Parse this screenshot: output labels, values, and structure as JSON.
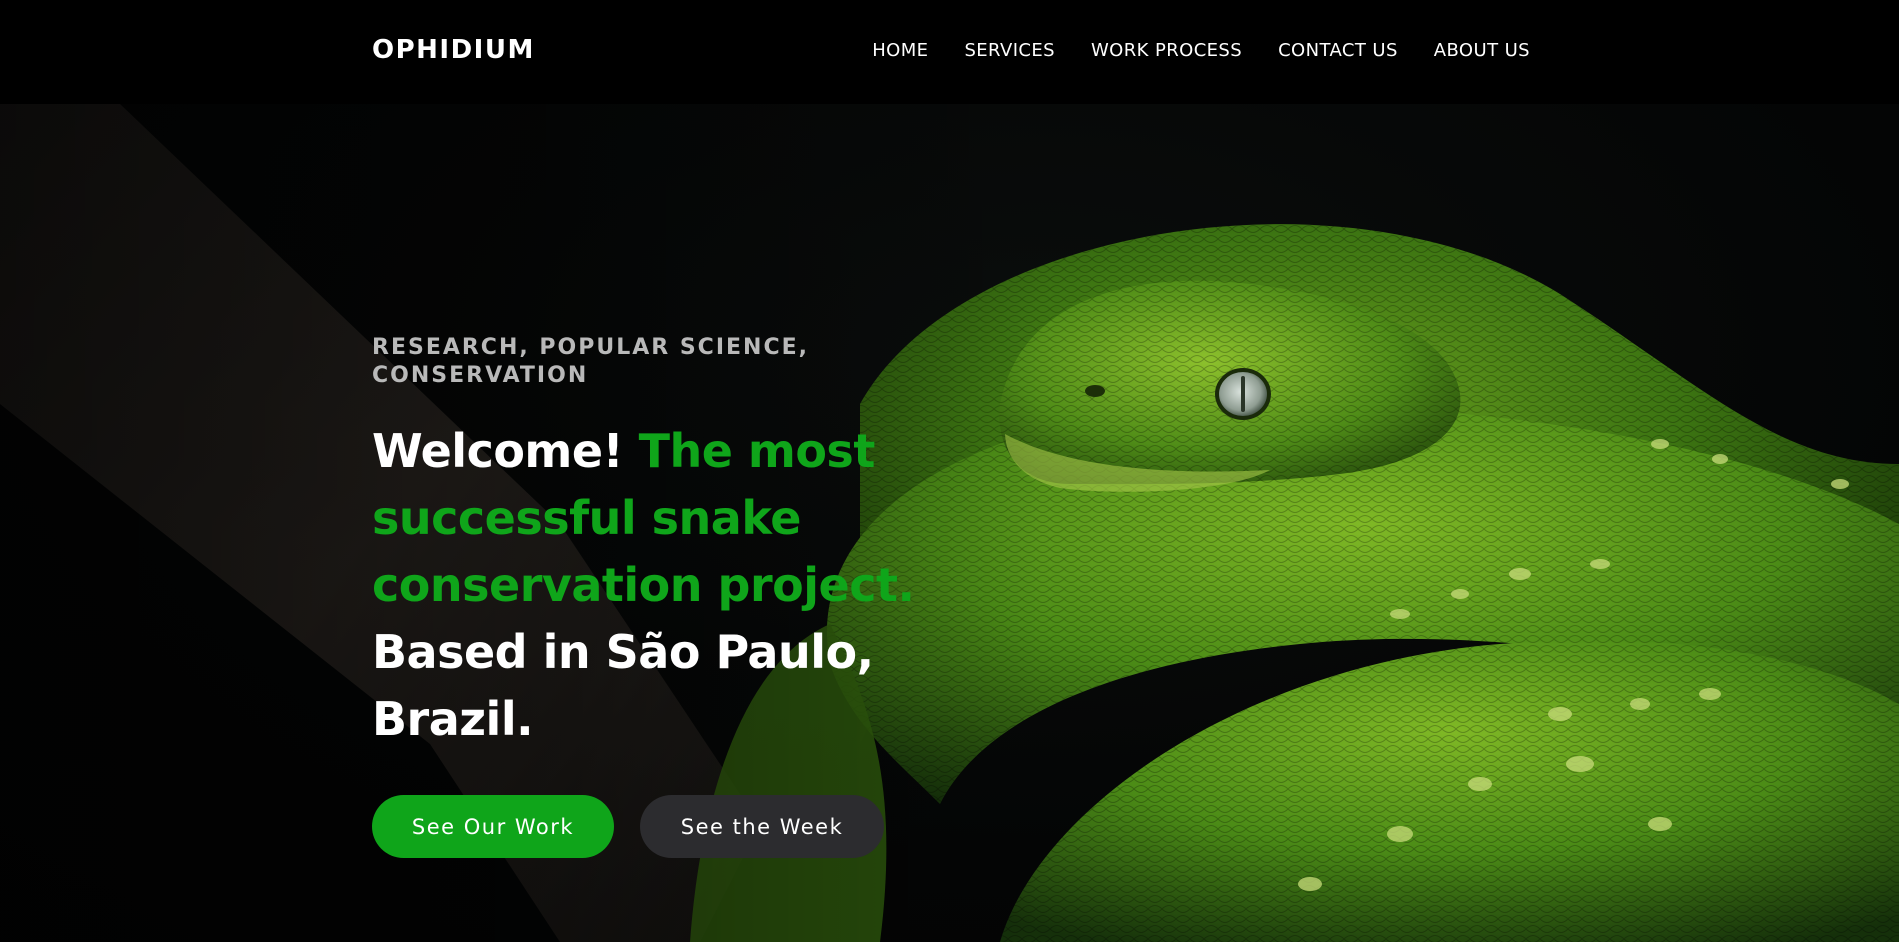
{
  "header": {
    "brand": "OPHIDIUM",
    "nav": [
      {
        "label": "HOME"
      },
      {
        "label": "SERVICES"
      },
      {
        "label": "WORK PROCESS"
      },
      {
        "label": "CONTACT US"
      },
      {
        "label": "ABOUT US"
      }
    ]
  },
  "hero": {
    "eyebrow": "RESEARCH, POPULAR SCIENCE, CONSERVATION",
    "headline_intro": "Welcome!",
    "headline_accent": "The most successful snake conservation project.",
    "headline_outro": "Based in São Paulo, Brazil.",
    "primary_button": "See Our Work",
    "secondary_button": "See the Week",
    "background_image": "green-tree-python-on-branch"
  },
  "colors": {
    "accent": "#0fa51a",
    "navbar_bg": "#000000",
    "secondary_button_bg": "#2c2c2f",
    "eyebrow_text": "#b9b9b9"
  }
}
